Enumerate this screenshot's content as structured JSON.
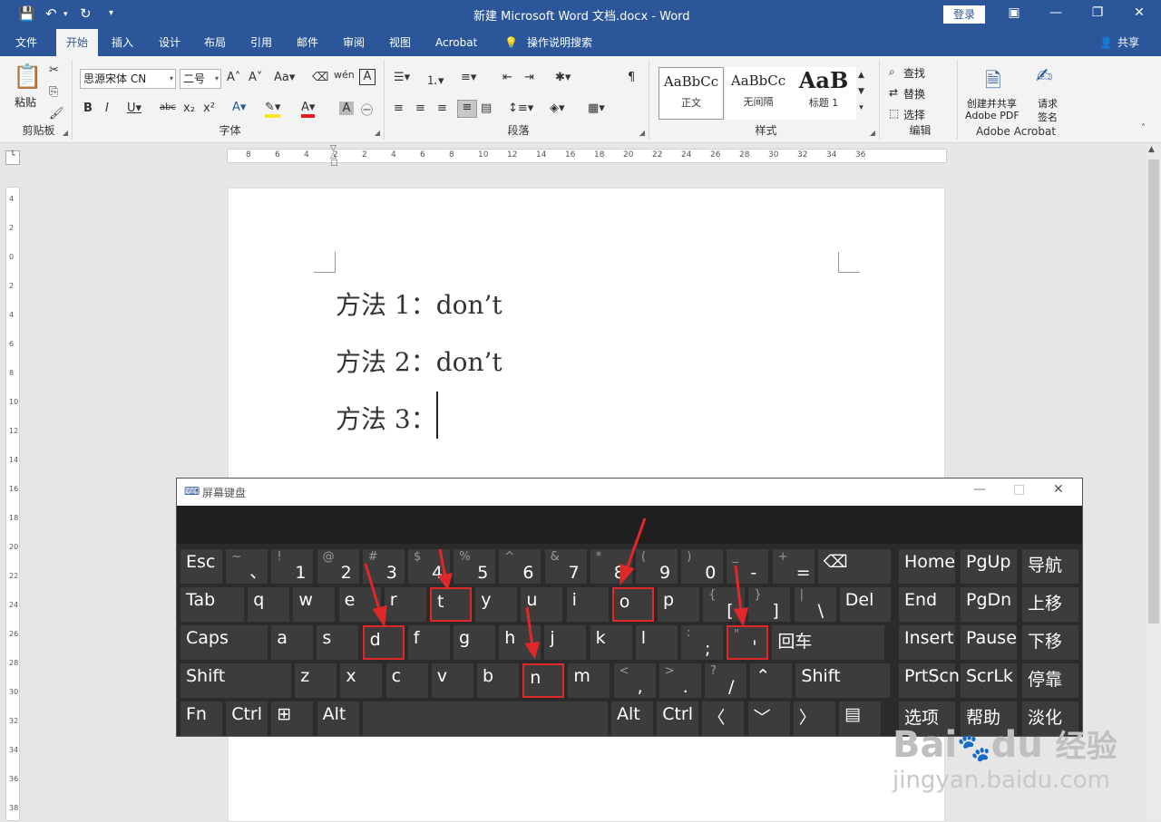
{
  "title": "新建 Microsoft Word 文档.docx  -  Word",
  "login_label": "登录",
  "quick_access": [
    "save-icon",
    "undo-icon",
    "redo-icon",
    "customize-icon"
  ],
  "tabs": [
    "文件",
    "开始",
    "插入",
    "设计",
    "布局",
    "引用",
    "邮件",
    "审阅",
    "视图",
    "Acrobat"
  ],
  "tell_me": "操作说明搜索",
  "share": "共享",
  "ribbon": {
    "clipboard": {
      "paste": "粘贴",
      "label": "剪贴板"
    },
    "font": {
      "name": "思源宋体 CN",
      "size": "二号",
      "label": "字体"
    },
    "paragraph": {
      "label": "段落"
    },
    "styles": {
      "label": "样式",
      "items": [
        {
          "preview": "AaBbCc",
          "name": "正文"
        },
        {
          "preview": "AaBbCc",
          "name": "无间隔"
        },
        {
          "preview": "AaB",
          "name": "标题 1"
        }
      ]
    },
    "editing": {
      "find": "查找",
      "replace": "替换",
      "select": "选择",
      "label": "编辑"
    },
    "acrobat": {
      "create": "创建并共享",
      "create2": "Adobe PDF",
      "sign": "请求",
      "sign2": "签名",
      "label": "Adobe Acrobat"
    }
  },
  "document": {
    "lines": [
      "方法 1：don’t",
      "方法 2：don’t",
      "方法 3："
    ]
  },
  "osk": {
    "title": "屏幕键盘",
    "rows": [
      {
        "keys": [
          {
            "l": "Esc"
          },
          {
            "s": "~",
            "p": "、"
          },
          {
            "s": "!",
            "p": "1"
          },
          {
            "s": "@",
            "p": "2"
          },
          {
            "s": "#",
            "p": "3"
          },
          {
            "s": "$",
            "p": "4"
          },
          {
            "s": "%",
            "p": "5"
          },
          {
            "s": "^",
            "p": "6"
          },
          {
            "s": "&",
            "p": "7"
          },
          {
            "s": "*",
            "p": "8"
          },
          {
            "s": "(",
            "p": "9"
          },
          {
            "s": ")",
            "p": "0"
          },
          {
            "s": "_",
            "p": "-"
          },
          {
            "s": "+",
            "p": "="
          },
          {
            "l": "⌫"
          }
        ]
      },
      {
        "keys": [
          {
            "l": "Tab"
          },
          {
            "l": "q"
          },
          {
            "l": "w"
          },
          {
            "l": "e"
          },
          {
            "l": "r"
          },
          {
            "l": "t"
          },
          {
            "l": "y"
          },
          {
            "l": "u"
          },
          {
            "l": "i"
          },
          {
            "l": "o"
          },
          {
            "l": "p"
          },
          {
            "s": "{",
            "p": "["
          },
          {
            "s": "}",
            "p": "]"
          },
          {
            "s": "|",
            "p": "\\"
          },
          {
            "l": "Del"
          }
        ]
      },
      {
        "keys": [
          {
            "l": "Caps"
          },
          {
            "l": "a"
          },
          {
            "l": "s"
          },
          {
            "l": "d"
          },
          {
            "l": "f"
          },
          {
            "l": "g"
          },
          {
            "l": "h"
          },
          {
            "l": "j"
          },
          {
            "l": "k"
          },
          {
            "l": "l"
          },
          {
            "s": ":",
            "p": ";"
          },
          {
            "s": "\"",
            "p": "'"
          },
          {
            "l": "回车"
          }
        ]
      },
      {
        "keys": [
          {
            "l": "Shift"
          },
          {
            "l": "z"
          },
          {
            "l": "x"
          },
          {
            "l": "c"
          },
          {
            "l": "v"
          },
          {
            "l": "b"
          },
          {
            "l": "n"
          },
          {
            "l": "m"
          },
          {
            "s": "<",
            "p": ","
          },
          {
            "s": ">",
            "p": "."
          },
          {
            "s": "?",
            "p": "/"
          },
          {
            "l": "⌃"
          },
          {
            "l": "Shift"
          }
        ]
      },
      {
        "keys": [
          {
            "l": "Fn"
          },
          {
            "l": "Ctrl"
          },
          {
            "l": "⊞"
          },
          {
            "l": "Alt"
          },
          {
            "l": ""
          },
          {
            "l": "Alt"
          },
          {
            "l": "Ctrl"
          },
          {
            "l": "〈"
          },
          {
            "l": "﹀"
          },
          {
            "l": "〉"
          },
          {
            "l": "▤"
          }
        ]
      }
    ],
    "nav": [
      [
        "Home",
        "PgUp",
        "导航"
      ],
      [
        "End",
        "PgDn",
        "上移"
      ],
      [
        "Insert",
        "Pause",
        "下移"
      ],
      [
        "PrtScn",
        "ScrLk",
        "停靠"
      ],
      [
        "选项",
        "帮助",
        "淡化"
      ]
    ],
    "highlighted": [
      "t",
      "d",
      "o",
      "n",
      "'"
    ]
  },
  "watermark": {
    "brand": "Bai",
    "du": "du",
    "cn": "经验",
    "url": "jingyan.baidu.com"
  }
}
